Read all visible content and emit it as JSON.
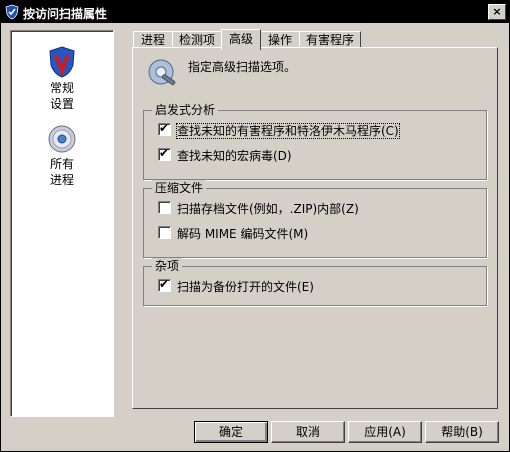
{
  "window": {
    "title": "按访问扫描属性",
    "app_icon": "shield-check-icon",
    "close_label": "×"
  },
  "sidebar": {
    "items": [
      {
        "label_line1": "常规",
        "label_line2": "设置",
        "icon": "shield-v-icon"
      },
      {
        "label_line1": "所有",
        "label_line2": "进程",
        "icon": "disc-icon"
      }
    ]
  },
  "tabs": [
    {
      "label": "进程"
    },
    {
      "label": "检测项"
    },
    {
      "label": "高级",
      "active": true
    },
    {
      "label": "操作"
    },
    {
      "label": "有害程序"
    }
  ],
  "panel": {
    "header_icon": "settings-wrench-icon",
    "header_text": "指定高级扫描选项。"
  },
  "groups": {
    "heuristic": {
      "title": "启发式分析",
      "options": [
        {
          "label": "查找未知的有害程序和特洛伊木马程序(C)",
          "checked": true,
          "focused": true
        },
        {
          "label": "查找未知的宏病毒(D)",
          "checked": true
        }
      ]
    },
    "compressed": {
      "title": "压缩文件",
      "options": [
        {
          "label": "扫描存档文件(例如，.ZIP)内部(Z)",
          "checked": false
        },
        {
          "label": "解码 MIME 编码文件(M)",
          "checked": false
        }
      ]
    },
    "misc": {
      "title": "杂项",
      "options": [
        {
          "label": "扫描为备份打开的文件(E)",
          "checked": true
        }
      ]
    }
  },
  "buttons": {
    "ok": "确定",
    "cancel": "取消",
    "apply": "应用(A)",
    "help": "帮助(B)"
  },
  "check_mark": "✔"
}
